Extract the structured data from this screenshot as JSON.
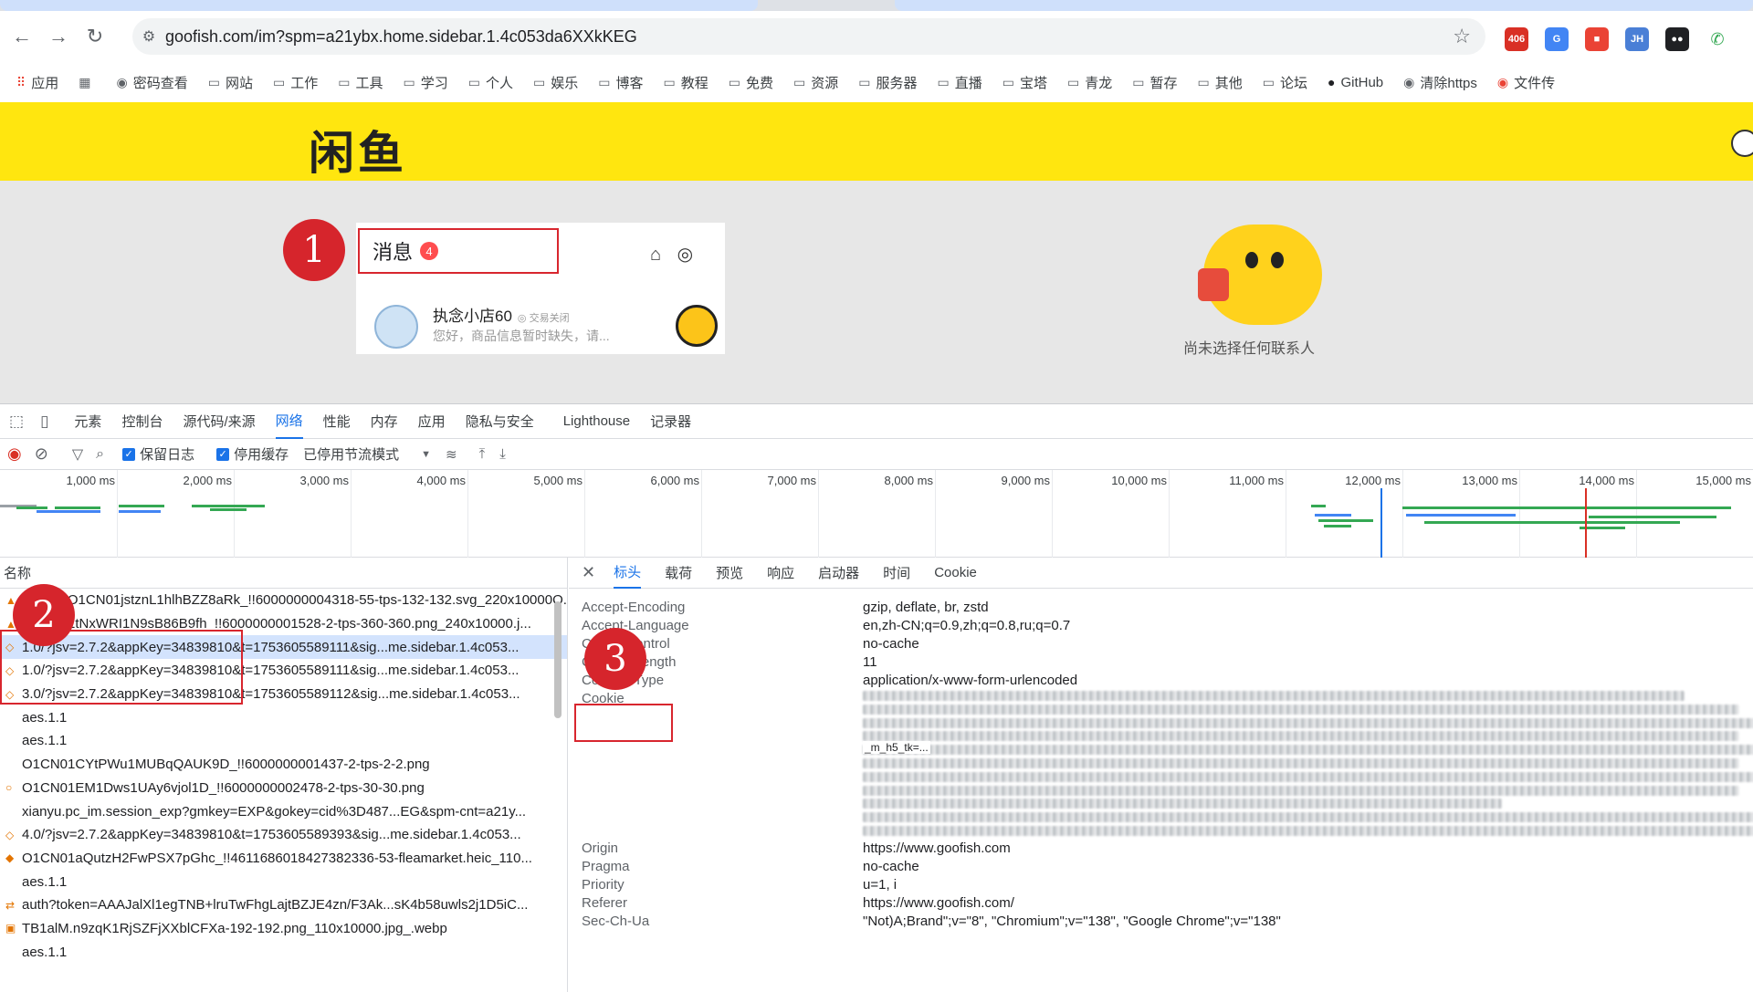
{
  "browser": {
    "url": "goofish.com/im?spm=a21ybx.home.sidebar.1.4c053da6XXkKEG",
    "ext_badge": "406",
    "bookmarks": [
      "应用",
      "密码查看",
      "网站",
      "工作",
      "工具",
      "学习",
      "个人",
      "娱乐",
      "博客",
      "教程",
      "免费",
      "资源",
      "服务器",
      "直播",
      "宝塔",
      "青龙",
      "暂存",
      "其他",
      "论坛",
      "GitHub",
      "清除https",
      "文件传"
    ]
  },
  "site": {
    "logo": "闲鱼",
    "messages_label": "消息",
    "messages_badge": "4",
    "conversation": {
      "name": "执念小店60",
      "tag": "◎ 交易关闭",
      "snippet": "您好，商品信息暂时缺失，请..."
    },
    "empty_text": "尚未选择任何联系人"
  },
  "callouts": [
    "1",
    "2",
    "3"
  ],
  "devtools": {
    "tabs": [
      "元素",
      "控制台",
      "源代码/来源",
      "网络",
      "性能",
      "内存",
      "应用",
      "隐私与安全",
      "Lighthouse",
      "记录器"
    ],
    "active_tab": "网络",
    "toolbar": {
      "preserve_log": "保留日志",
      "disable_cache": "停用缓存",
      "throttle": "已停用节流模式"
    },
    "timeline_ticks": [
      "1,000 ms",
      "2,000 ms",
      "3,000 ms",
      "4,000 ms",
      "5,000 ms",
      "6,000 ms",
      "7,000 ms",
      "8,000 ms",
      "9,000 ms",
      "10,000 ms",
      "11,000 ms",
      "12,000 ms",
      "13,000 ms",
      "14,000 ms",
      "15,000 ms"
    ],
    "name_column": "名称",
    "requests": [
      "O1CN01jstznL1hlhBZZ8aRk_!!6000000004318-55-tps-132-132.svg_220x10000Q...",
      "O1CN01tNxWRI1N9sB86B9fh_!!6000000001528-2-tps-360-360.png_240x10000.j...",
      "1.0/?jsv=2.7.2&appKey=34839810&t=1753605589111&sig...me.sidebar.1.4c053...",
      "1.0/?jsv=2.7.2&appKey=34839810&t=1753605589111&sig...me.sidebar.1.4c053...",
      "3.0/?jsv=2.7.2&appKey=34839810&t=1753605589112&sig...me.sidebar.1.4c053...",
      "aes.1.1",
      "aes.1.1",
      "O1CN01CYtPWu1MUBqQAUK9D_!!6000000001437-2-tps-2-2.png",
      "O1CN01EM1Dws1UAy6vjol1D_!!6000000002478-2-tps-30-30.png",
      "xianyu.pc_im.session_exp?gmkey=EXP&gokey=cid%3D487...EG&spm-cnt=a21y...",
      "4.0/?jsv=2.7.2&appKey=34839810&t=1753605589393&sig...me.sidebar.1.4c053...",
      "O1CN01aQutzH2FwPSX7pGhc_!!4611686018427382336-53-fleamarket.heic_110...",
      "aes.1.1",
      "auth?token=AAAJalXl1egTNB+lruTwFhgLajtBZJE4zn/F3Ak...sK4b58uwls2j1D5iC...",
      "TB1alM.n9zqK1RjSZFjXXblCFXa-192-192.png_110x10000.jpg_.webp",
      "aes.1.1"
    ],
    "detail_tabs": [
      "标头",
      "载荷",
      "预览",
      "响应",
      "启动器",
      "时间",
      "Cookie"
    ],
    "active_detail_tab": "标头",
    "headers": [
      {
        "name": "Accept-Encoding",
        "value": "gzip, deflate, br, zstd"
      },
      {
        "name": "Accept-Language",
        "value": "en,zh-CN;q=0.9,zh;q=0.8,ru;q=0.7"
      },
      {
        "name": "Cache-Control",
        "value": "no-cache"
      },
      {
        "name": "Content-Length",
        "value": "11"
      },
      {
        "name": "Content-Type",
        "value": "application/x-www-form-urlencoded"
      },
      {
        "name": "Cookie",
        "value": ""
      },
      {
        "name": "Origin",
        "value": "https://www.goofish.com"
      },
      {
        "name": "Pragma",
        "value": "no-cache"
      },
      {
        "name": "Priority",
        "value": "u=1, i"
      },
      {
        "name": "Referer",
        "value": "https://www.goofish.com/"
      },
      {
        "name": "Sec-Ch-Ua",
        "value": "\"Not)A;Brand\";v=\"8\", \"Chromium\";v=\"138\", \"Google Chrome\";v=\"138\""
      }
    ],
    "cookie_snippet": "_m_h5_tk=..."
  }
}
